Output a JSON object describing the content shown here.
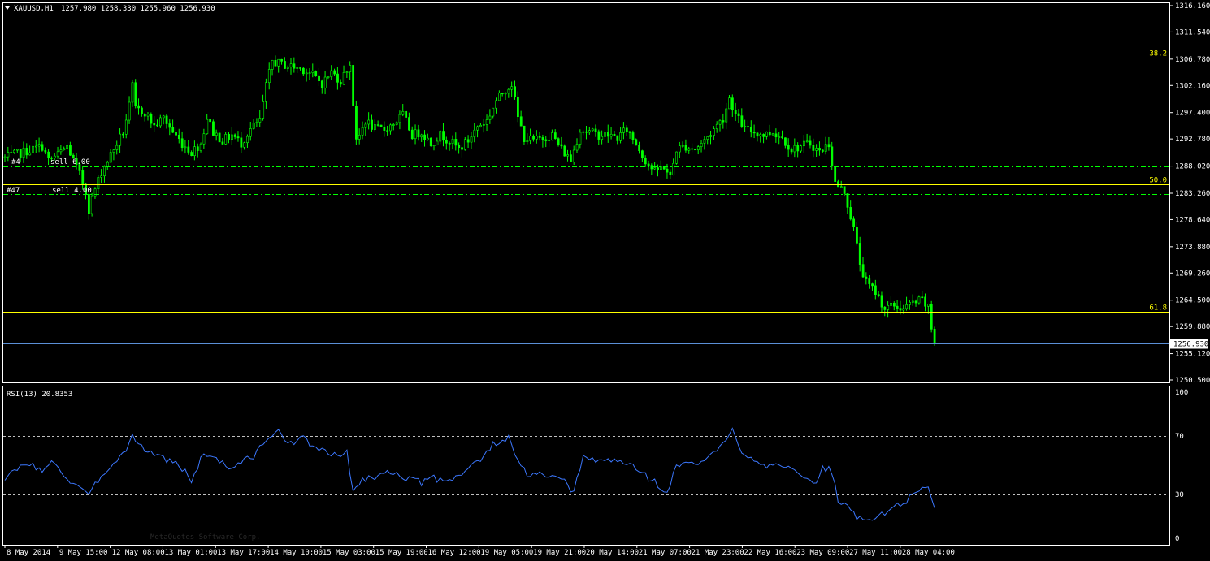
{
  "header": {
    "symbol_timeframe": "XAUUSD,H1",
    "ohlc": "1257.980 1258.330 1255.960 1256.930",
    "rsi_title": "RSI(13) 20.8353",
    "watermark": "MetaQuotes Software Corp.",
    "order_label_1": "#4",
    "order_text_1": "sell 6.00",
    "order_label_2": "#47",
    "order_text_2": "sell 4.00"
  },
  "colors": {
    "background": "#000000",
    "bull_candle": "#00ff00",
    "bear_candle": "#00ff00",
    "fib_line": "#ffff00",
    "fib_label": "#ffff00",
    "order_line": "#00ff00",
    "bid_line": "#5b8fd6",
    "rsi_line": "#3c78ff",
    "axis_text": "#ffffff",
    "frame": "#ffffff"
  },
  "chart_data": [
    {
      "type": "candlestick",
      "symbol": "XAUUSD",
      "timeframe": "H1",
      "ylim": [
        1250.5,
        1316.16
      ],
      "y_ticks": [
        "1316.160",
        "1311.540",
        "1306.780",
        "1302.160",
        "1297.400",
        "1292.780",
        "1288.020",
        "1283.260",
        "1278.640",
        "1273.880",
        "1269.260",
        "1264.500",
        "1259.880",
        "1255.120",
        "1250.500"
      ],
      "x_ticks": [
        "8 May 2014",
        "9 May 15:00",
        "12 May 08:00",
        "13 May 01:00",
        "13 May 17:00",
        "14 May 10:00",
        "15 May 03:00",
        "15 May 19:00",
        "16 May 12:00",
        "19 May 05:00",
        "19 May 21:00",
        "20 May 14:00",
        "21 May 07:00",
        "21 May 23:00",
        "22 May 16:00",
        "23 May 09:00",
        "27 May 11:00",
        "28 May 04:00"
      ],
      "close_path": [
        {
          "bar": 0,
          "price": 1289.5
        },
        {
          "bar": 6,
          "price": 1290.5
        },
        {
          "bar": 12,
          "price": 1291.5
        },
        {
          "bar": 14,
          "price": 1289.0
        },
        {
          "bar": 17,
          "price": 1290.0
        },
        {
          "bar": 20,
          "price": 1291.5
        },
        {
          "bar": 22,
          "price": 1289.0
        },
        {
          "bar": 24,
          "price": 1286.5
        },
        {
          "bar": 26,
          "price": 1283.5
        },
        {
          "bar": 27,
          "price": 1280.5
        },
        {
          "bar": 29,
          "price": 1284.0
        },
        {
          "bar": 31,
          "price": 1287.0
        },
        {
          "bar": 33,
          "price": 1289.0
        },
        {
          "bar": 35,
          "price": 1291.0
        },
        {
          "bar": 38,
          "price": 1294.0
        },
        {
          "bar": 40,
          "price": 1298.5
        },
        {
          "bar": 41,
          "price": 1302.0
        },
        {
          "bar": 42,
          "price": 1298.0
        },
        {
          "bar": 45,
          "price": 1297.5
        },
        {
          "bar": 48,
          "price": 1295.0
        },
        {
          "bar": 51,
          "price": 1296.5
        },
        {
          "bar": 54,
          "price": 1294.0
        },
        {
          "bar": 57,
          "price": 1292.0
        },
        {
          "bar": 60,
          "price": 1290.5
        },
        {
          "bar": 63,
          "price": 1292.0
        },
        {
          "bar": 65,
          "price": 1296.5
        },
        {
          "bar": 67,
          "price": 1294.0
        },
        {
          "bar": 70,
          "price": 1292.5
        },
        {
          "bar": 73,
          "price": 1293.5
        },
        {
          "bar": 76,
          "price": 1292.0
        },
        {
          "bar": 79,
          "price": 1294.5
        },
        {
          "bar": 82,
          "price": 1296.0
        },
        {
          "bar": 84,
          "price": 1302.0
        },
        {
          "bar": 86,
          "price": 1306.5
        },
        {
          "bar": 88,
          "price": 1306.0
        },
        {
          "bar": 92,
          "price": 1305.5
        },
        {
          "bar": 96,
          "price": 1305.0
        },
        {
          "bar": 99,
          "price": 1304.0
        },
        {
          "bar": 102,
          "price": 1302.5
        },
        {
          "bar": 105,
          "price": 1304.5
        },
        {
          "bar": 108,
          "price": 1303.0
        },
        {
          "bar": 111,
          "price": 1306.0
        },
        {
          "bar": 113,
          "price": 1292.0
        },
        {
          "bar": 116,
          "price": 1296.0
        },
        {
          "bar": 119,
          "price": 1294.5
        },
        {
          "bar": 122,
          "price": 1294.5
        },
        {
          "bar": 125,
          "price": 1295.5
        },
        {
          "bar": 128,
          "price": 1297.0
        },
        {
          "bar": 131,
          "price": 1293.5
        },
        {
          "bar": 134,
          "price": 1294.0
        },
        {
          "bar": 137,
          "price": 1292.0
        },
        {
          "bar": 140,
          "price": 1293.5
        },
        {
          "bar": 143,
          "price": 1292.5
        },
        {
          "bar": 146,
          "price": 1291.0
        },
        {
          "bar": 149,
          "price": 1292.5
        },
        {
          "bar": 152,
          "price": 1295.0
        },
        {
          "bar": 155,
          "price": 1296.0
        },
        {
          "bar": 158,
          "price": 1299.5
        },
        {
          "bar": 161,
          "price": 1301.5
        },
        {
          "bar": 163,
          "price": 1302.5
        },
        {
          "bar": 165,
          "price": 1296.5
        },
        {
          "bar": 167,
          "price": 1293.0
        },
        {
          "bar": 170,
          "price": 1292.5
        },
        {
          "bar": 173,
          "price": 1293.0
        },
        {
          "bar": 176,
          "price": 1293.5
        },
        {
          "bar": 179,
          "price": 1291.0
        },
        {
          "bar": 182,
          "price": 1289.0
        },
        {
          "bar": 185,
          "price": 1294.5
        },
        {
          "bar": 188,
          "price": 1294.0
        },
        {
          "bar": 191,
          "price": 1293.5
        },
        {
          "bar": 194,
          "price": 1293.5
        },
        {
          "bar": 197,
          "price": 1293.0
        },
        {
          "bar": 200,
          "price": 1294.5
        },
        {
          "bar": 203,
          "price": 1292.0
        },
        {
          "bar": 206,
          "price": 1289.0
        },
        {
          "bar": 209,
          "price": 1287.0
        },
        {
          "bar": 212,
          "price": 1288.0
        },
        {
          "bar": 214,
          "price": 1286.0
        },
        {
          "bar": 216,
          "price": 1291.0
        },
        {
          "bar": 219,
          "price": 1291.5
        },
        {
          "bar": 222,
          "price": 1291.0
        },
        {
          "bar": 225,
          "price": 1292.5
        },
        {
          "bar": 228,
          "price": 1294.5
        },
        {
          "bar": 231,
          "price": 1296.5
        },
        {
          "bar": 233,
          "price": 1300.0
        },
        {
          "bar": 235,
          "price": 1297.0
        },
        {
          "bar": 238,
          "price": 1294.5
        },
        {
          "bar": 241,
          "price": 1294.0
        },
        {
          "bar": 244,
          "price": 1293.5
        },
        {
          "bar": 247,
          "price": 1294.0
        },
        {
          "bar": 250,
          "price": 1293.0
        },
        {
          "bar": 253,
          "price": 1291.0
        },
        {
          "bar": 256,
          "price": 1291.5
        },
        {
          "bar": 259,
          "price": 1292.0
        },
        {
          "bar": 262,
          "price": 1290.5
        },
        {
          "bar": 265,
          "price": 1292.0
        },
        {
          "bar": 267,
          "price": 1285.0
        },
        {
          "bar": 270,
          "price": 1283.5
        },
        {
          "bar": 273,
          "price": 1277.0
        },
        {
          "bar": 275,
          "price": 1271.0
        },
        {
          "bar": 277,
          "price": 1267.5
        },
        {
          "bar": 280,
          "price": 1266.0
        },
        {
          "bar": 283,
          "price": 1263.0
        },
        {
          "bar": 286,
          "price": 1263.5
        },
        {
          "bar": 289,
          "price": 1263.0
        },
        {
          "bar": 292,
          "price": 1264.0
        },
        {
          "bar": 295,
          "price": 1264.5
        },
        {
          "bar": 297,
          "price": 1263.0
        },
        {
          "bar": 298,
          "price": 1259.5
        },
        {
          "bar": 299,
          "price": 1256.93
        }
      ],
      "fibonacci_levels": [
        {
          "label": "38.2",
          "price": 1307.1
        },
        {
          "label": "50.0",
          "price": 1284.8
        },
        {
          "label": "61.8",
          "price": 1262.4
        }
      ],
      "order_lines": [
        {
          "price": 1288.0
        },
        {
          "price": 1283.1
        }
      ],
      "bid_price_label": "1256.930",
      "bid_price": 1256.93
    },
    {
      "type": "line",
      "title": "RSI(13) 20.8353",
      "ylim": [
        0,
        100
      ],
      "y_ticks": [
        "100",
        "70",
        "30",
        "0"
      ],
      "levels": [
        70,
        30
      ],
      "series": [
        {
          "values_path": [
            {
              "bar": 0,
              "value": 41
            },
            {
              "bar": 4,
              "value": 47
            },
            {
              "bar": 8,
              "value": 52
            },
            {
              "bar": 12,
              "value": 45
            },
            {
              "bar": 16,
              "value": 53
            },
            {
              "bar": 20,
              "value": 40
            },
            {
              "bar": 24,
              "value": 36
            },
            {
              "bar": 27,
              "value": 28
            },
            {
              "bar": 30,
              "value": 40
            },
            {
              "bar": 34,
              "value": 50
            },
            {
              "bar": 38,
              "value": 58
            },
            {
              "bar": 41,
              "value": 70
            },
            {
              "bar": 44,
              "value": 62
            },
            {
              "bar": 48,
              "value": 58
            },
            {
              "bar": 52,
              "value": 54
            },
            {
              "bar": 56,
              "value": 50
            },
            {
              "bar": 60,
              "value": 40
            },
            {
              "bar": 64,
              "value": 58
            },
            {
              "bar": 68,
              "value": 55
            },
            {
              "bar": 72,
              "value": 48
            },
            {
              "bar": 76,
              "value": 52
            },
            {
              "bar": 80,
              "value": 56
            },
            {
              "bar": 84,
              "value": 68
            },
            {
              "bar": 88,
              "value": 72
            },
            {
              "bar": 92,
              "value": 66
            },
            {
              "bar": 96,
              "value": 68
            },
            {
              "bar": 100,
              "value": 62
            },
            {
              "bar": 104,
              "value": 58
            },
            {
              "bar": 108,
              "value": 55
            },
            {
              "bar": 110,
              "value": 60
            },
            {
              "bar": 112,
              "value": 32
            },
            {
              "bar": 115,
              "value": 40
            },
            {
              "bar": 118,
              "value": 42
            },
            {
              "bar": 122,
              "value": 44
            },
            {
              "bar": 126,
              "value": 46
            },
            {
              "bar": 130,
              "value": 40
            },
            {
              "bar": 134,
              "value": 38
            },
            {
              "bar": 138,
              "value": 41
            },
            {
              "bar": 142,
              "value": 40
            },
            {
              "bar": 146,
              "value": 43
            },
            {
              "bar": 150,
              "value": 50
            },
            {
              "bar": 154,
              "value": 55
            },
            {
              "bar": 157,
              "value": 64
            },
            {
              "bar": 160,
              "value": 68
            },
            {
              "bar": 162,
              "value": 68
            },
            {
              "bar": 165,
              "value": 52
            },
            {
              "bar": 168,
              "value": 44
            },
            {
              "bar": 172,
              "value": 43
            },
            {
              "bar": 176,
              "value": 42
            },
            {
              "bar": 180,
              "value": 38
            },
            {
              "bar": 183,
              "value": 32
            },
            {
              "bar": 186,
              "value": 55
            },
            {
              "bar": 190,
              "value": 53
            },
            {
              "bar": 194,
              "value": 54
            },
            {
              "bar": 198,
              "value": 52
            },
            {
              "bar": 202,
              "value": 50
            },
            {
              "bar": 206,
              "value": 43
            },
            {
              "bar": 210,
              "value": 37
            },
            {
              "bar": 213,
              "value": 30
            },
            {
              "bar": 216,
              "value": 50
            },
            {
              "bar": 220,
              "value": 51
            },
            {
              "bar": 224,
              "value": 52
            },
            {
              "bar": 228,
              "value": 58
            },
            {
              "bar": 232,
              "value": 66
            },
            {
              "bar": 234,
              "value": 74
            },
            {
              "bar": 237,
              "value": 60
            },
            {
              "bar": 241,
              "value": 54
            },
            {
              "bar": 245,
              "value": 50
            },
            {
              "bar": 249,
              "value": 52
            },
            {
              "bar": 253,
              "value": 47
            },
            {
              "bar": 257,
              "value": 40
            },
            {
              "bar": 260,
              "value": 36
            },
            {
              "bar": 263,
              "value": 48
            },
            {
              "bar": 266,
              "value": 46
            },
            {
              "bar": 268,
              "value": 26
            },
            {
              "bar": 271,
              "value": 22
            },
            {
              "bar": 274,
              "value": 14
            },
            {
              "bar": 277,
              "value": 12
            },
            {
              "bar": 280,
              "value": 15
            },
            {
              "bar": 283,
              "value": 17
            },
            {
              "bar": 286,
              "value": 22
            },
            {
              "bar": 289,
              "value": 24
            },
            {
              "bar": 292,
              "value": 29
            },
            {
              "bar": 295,
              "value": 34
            },
            {
              "bar": 297,
              "value": 36
            },
            {
              "bar": 299,
              "value": 20.8353
            }
          ]
        }
      ]
    }
  ]
}
